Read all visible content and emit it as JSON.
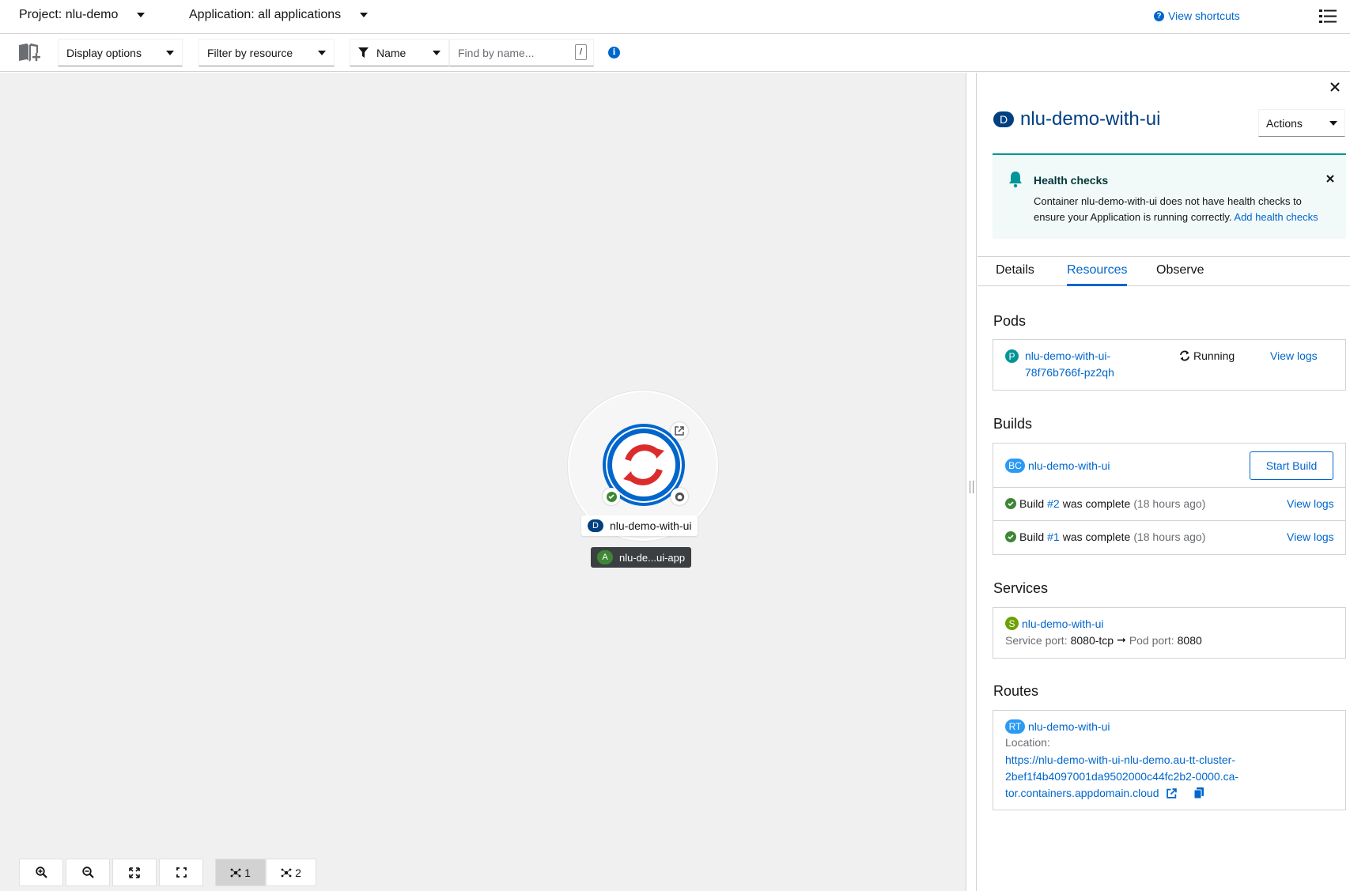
{
  "topbar": {
    "project_label": "Project: nlu-demo",
    "application_label": "Application: all applications",
    "view_shortcuts": "View shortcuts"
  },
  "toolbar": {
    "display_options": "Display options",
    "filter_by_resource": "Filter by resource",
    "filter_type": "Name",
    "search_placeholder": "Find by name...",
    "search_shortcut": "/"
  },
  "canvas": {
    "node": {
      "kind_badge": "D",
      "name": "nlu-demo-with-ui"
    },
    "application_group": {
      "kind_badge": "A",
      "name": "nlu-de...ui-app"
    },
    "layout_buttons": [
      {
        "label": "1",
        "active": true
      },
      {
        "label": "2",
        "active": false
      }
    ]
  },
  "panel": {
    "kind_badge": "D",
    "title": "nlu-demo-with-ui",
    "actions_label": "Actions",
    "alert": {
      "title": "Health checks",
      "body": "Container nlu-demo-with-ui does not have health checks to ensure your Application is running correctly.",
      "link": "Add health checks"
    },
    "tabs": [
      "Details",
      "Resources",
      "Observe"
    ],
    "active_tab": "Resources",
    "pods": {
      "heading": "Pods",
      "badge": "P",
      "name_line1": "nlu-demo-with-ui-",
      "name_line2": "78f76b766f-pz2qh",
      "status": "Running",
      "view_logs": "View logs"
    },
    "builds": {
      "heading": "Builds",
      "badge": "BC",
      "config_name": "nlu-demo-with-ui",
      "start_build": "Start Build",
      "items": [
        {
          "prefix": "Build",
          "number": "#2",
          "suffix": "was complete",
          "time": "(18 hours ago)",
          "view_logs": "View logs"
        },
        {
          "prefix": "Build",
          "number": "#1",
          "suffix": "was complete",
          "time": "(18 hours ago)",
          "view_logs": "View logs"
        }
      ]
    },
    "services": {
      "heading": "Services",
      "badge": "S",
      "name": "nlu-demo-with-ui",
      "service_port_label": "Service port:",
      "service_port": "8080-tcp",
      "arrow": "➞",
      "pod_port_label": "Pod port:",
      "pod_port": "8080"
    },
    "routes": {
      "heading": "Routes",
      "badge": "RT",
      "name": "nlu-demo-with-ui",
      "location_label": "Location:",
      "url_line1": "https://nlu-demo-with-ui-nlu-demo.au-tt-cluster-",
      "url_line2": "2bef1f4b4097001da9502000c44fc2b2-0000.ca-",
      "url_line3": "tor.containers.appdomain.cloud"
    }
  },
  "colors": {
    "link": "#0066cc",
    "deployment_badge": "#004080",
    "pod_badge": "#009596",
    "build_badge": "#2b9af3",
    "service_badge": "#6ca100",
    "route_badge": "#2b9af3",
    "success": "#3e8635",
    "app_badge": "#3e8635"
  }
}
